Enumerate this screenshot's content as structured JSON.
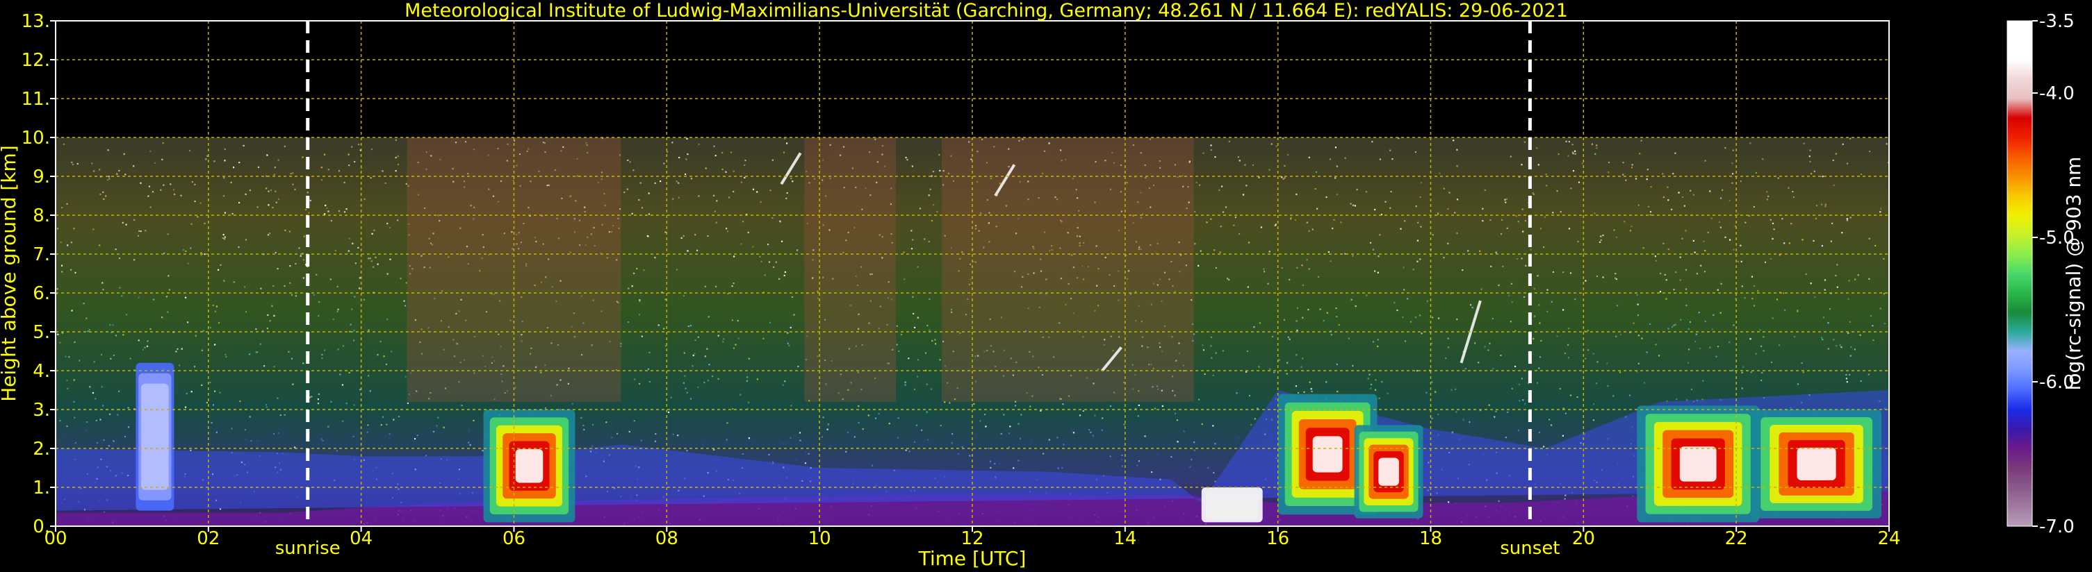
{
  "chart_data": {
    "type": "heatmap",
    "title": "Meteorological Institute of Ludwig-Maximilians-Universität (Garching, Germany; 48.261 N / 11.664 E):    redYALIS: 29-06-2021",
    "xlabel": "Time [UTC]",
    "ylabel": "Height above ground [km]",
    "xlim": [
      0,
      24
    ],
    "ylim": [
      0,
      13
    ],
    "x_ticks": [
      "00",
      "02",
      "04",
      "06",
      "08",
      "10",
      "12",
      "14",
      "16",
      "18",
      "20",
      "22",
      "24"
    ],
    "y_ticks": [
      "0.",
      "1.",
      "2.",
      "3.",
      "4.",
      "5.",
      "6.",
      "7.",
      "8.",
      "9.",
      "10.",
      "11.",
      "12.",
      "13."
    ],
    "grid": true,
    "data_ceiling_km": 10,
    "events": [
      {
        "label": "sunrise",
        "time": 3.3
      },
      {
        "label": "sunset",
        "time": 19.3
      }
    ],
    "colorbar": {
      "label": "log(rc-signal) @ 903 nm",
      "min": -7.0,
      "max": -3.5,
      "tick_labels": [
        "-3.5",
        "-4.0",
        "-5.0",
        "-6.0",
        "-7.0"
      ],
      "tick_values": [
        -3.5,
        -4.0,
        -5.0,
        -6.0,
        -7.0
      ],
      "colors": [
        "#b8a0b8",
        "#a07aa0",
        "#8a5a8a",
        "#7a3a7a",
        "#6a1a8a",
        "#3a1aaa",
        "#1a2ae8",
        "#4a6cff",
        "#7a98ff",
        "#9ab0ff",
        "#2aaa9a",
        "#1a8a3a",
        "#2ab84a",
        "#4ad86a",
        "#8aee4a",
        "#c8f02a",
        "#f0f000",
        "#f8c800",
        "#f89000",
        "#f85a00",
        "#f02000",
        "#d80000",
        "#e8c0c0",
        "#f0d8d8",
        "#ffffff",
        "#ffffff",
        "#ffffff"
      ]
    },
    "colors": {
      "text": "#ffff00",
      "grid": "#c8b400",
      "background": "#000000",
      "event_line": "#ffffff"
    }
  }
}
